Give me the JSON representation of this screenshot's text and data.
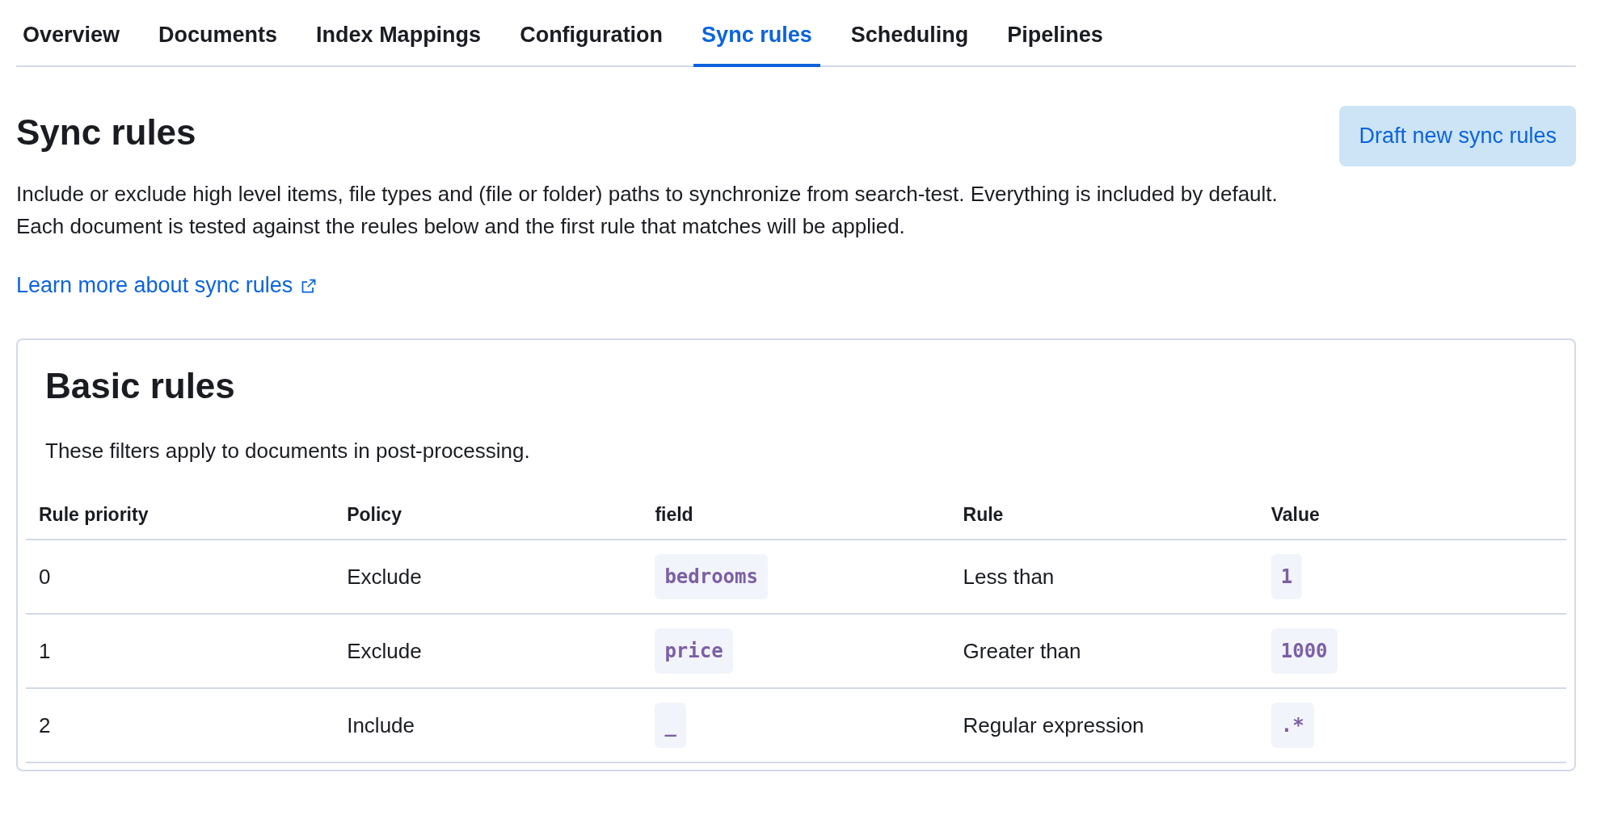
{
  "tabs": [
    {
      "label": "Overview",
      "selected": false
    },
    {
      "label": "Documents",
      "selected": false
    },
    {
      "label": "Index Mappings",
      "selected": false
    },
    {
      "label": "Configuration",
      "selected": false
    },
    {
      "label": "Sync rules",
      "selected": true
    },
    {
      "label": "Scheduling",
      "selected": false
    },
    {
      "label": "Pipelines",
      "selected": false
    }
  ],
  "header": {
    "title": "Sync rules",
    "button": "Draft new sync rules"
  },
  "description": "Include or exclude high level items, file types and (file or folder) paths to synchronize from search-test. Everything is included by default. Each document is tested against the reules below and the first rule that matches will be applied.",
  "learn_more_link": "Learn more about sync rules",
  "basic_rules": {
    "title": "Basic rules",
    "description": "These filters apply to documents in post-processing.",
    "table": {
      "columns": [
        "Rule priority",
        "Policy",
        "field",
        "Rule",
        "Value"
      ],
      "rows": [
        {
          "priority": "0",
          "policy": "Exclude",
          "field": "bedrooms",
          "rule": "Less than",
          "value": "1"
        },
        {
          "priority": "1",
          "policy": "Exclude",
          "field": "price",
          "rule": "Greater than",
          "value": "1000"
        },
        {
          "priority": "2",
          "policy": "Include",
          "field": "_",
          "rule": "Regular expression",
          "value": ".*"
        }
      ]
    }
  }
}
